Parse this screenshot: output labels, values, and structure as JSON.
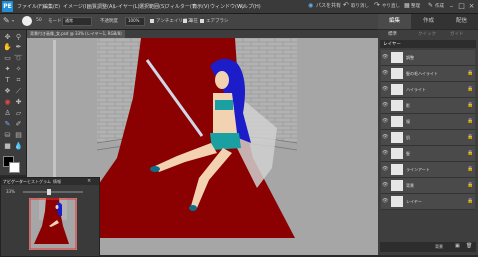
{
  "app": {
    "logo": "PE"
  },
  "menu": [
    "ファイル(F)",
    "編集(E)",
    "イメージ(I)",
    "画質調整(A)",
    "レイヤー(L)",
    "選択範囲(S)",
    "フィルター(T)",
    "表示(V)",
    "ウィンドウ(W)",
    "ヘルプ(H)"
  ],
  "right_tools": {
    "share_label": "パスを共有",
    "undo_label": "取り消し",
    "redo_label": "やり直し",
    "organize_label": "整理",
    "create_label": "作成"
  },
  "options": {
    "size_value": "50",
    "mode_label": "モード",
    "mode_value": "通常",
    "opacity_label": "不透明度",
    "opacity_value": "100%",
    "antialias_label": "アンチエイリアス",
    "pressure_label": "筆圧",
    "air_label": "エアブラシ"
  },
  "panel_tabs": [
    "編集",
    "作成",
    "配信"
  ],
  "panel_subtabs": [
    "標準",
    "クイック",
    "ガイド"
  ],
  "document": {
    "tab_label": "背景付き画像_女.psd @ 33% (レイヤー1, RGB/8)"
  },
  "layers": {
    "header": "レイヤー",
    "items": [
      {
        "name": "調整"
      },
      {
        "name": "髪の毛ハイライト"
      },
      {
        "name": "ハイライト"
      },
      {
        "name": "影"
      },
      {
        "name": "服"
      },
      {
        "name": "肌"
      },
      {
        "name": "髪"
      },
      {
        "name": "ラインアート"
      },
      {
        "name": "背景"
      },
      {
        "name": "レイヤー"
      }
    ],
    "footer_label": "背景"
  },
  "navigator": {
    "tabs": [
      "ナビゲーター",
      "ヒストグラム",
      "情報"
    ],
    "zoom": "33%"
  },
  "colors": {
    "accent": "#1f8fd6",
    "carpet": "#8b0000",
    "canvas_bg": "#a6a6a6"
  }
}
